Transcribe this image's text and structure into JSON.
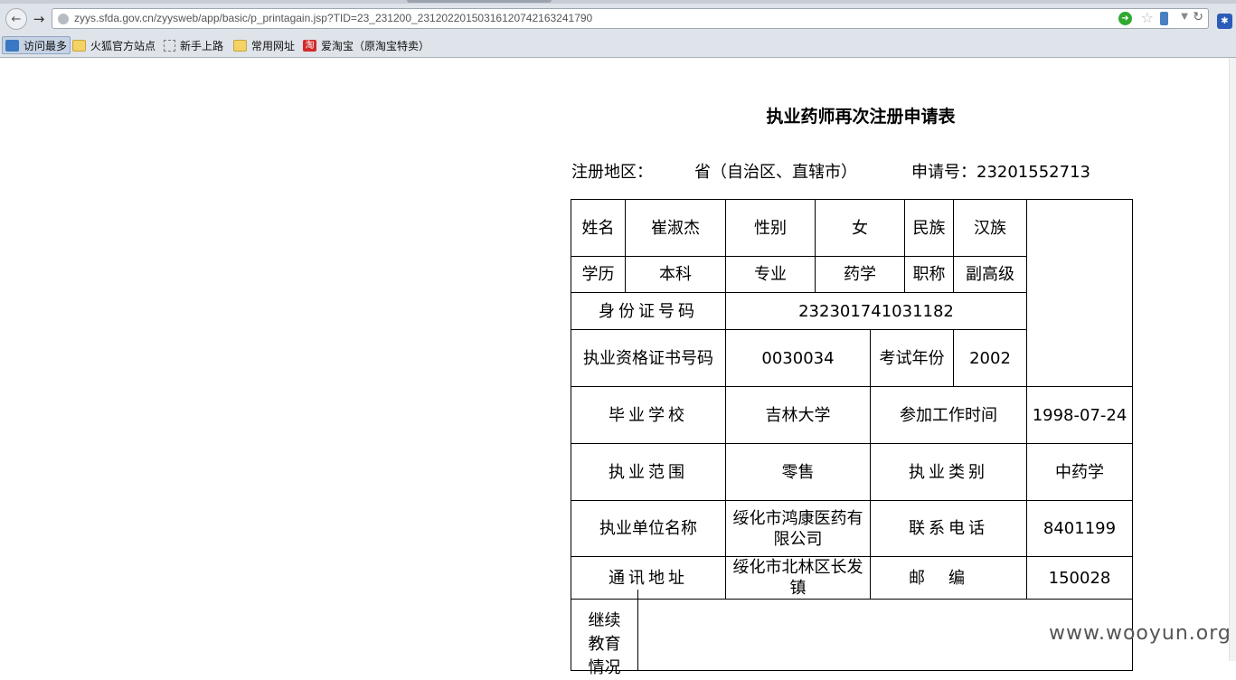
{
  "browser": {
    "url": "zyys.sfda.gov.cn/zyysweb/app/basic/p_printagain.jsp?TID=23_231200_23120220150316120742163241790",
    "bookmarks": [
      "访问最多",
      "火狐官方站点",
      "新手上路",
      "常用网址",
      "爱淘宝（原淘宝特卖）"
    ],
    "taobao_glyph": "淘"
  },
  "form": {
    "title": "执业药师再次注册申请表",
    "region_label": "注册地区：",
    "region_value": "省（自治区、直辖市）",
    "application_no": "申请号：23201552713",
    "rows": {
      "name_label": "姓名",
      "name_value": "崔淑杰",
      "gender_label": "性别",
      "gender_value": "女",
      "ethnic_label": "民族",
      "ethnic_value": "汉族",
      "edu_label": "学历",
      "edu_value": "本科",
      "major_label": "专业",
      "major_value": "药学",
      "title_label": "职称",
      "title_value": "副高级",
      "id_label": "身份证号码",
      "id_value": "232301741031182",
      "cert_label": "执业资格证书号码",
      "cert_value": "0030034",
      "exam_year_label": "考试年份",
      "exam_year_value": "2002",
      "school_label": "毕业学校",
      "school_value": "吉林大学",
      "work_start_label": "参加工作时间",
      "work_start_value": "1998-07-24",
      "scope_label": "执业范围",
      "scope_value": "零售",
      "category_label": "执业类别",
      "category_value": "中药学",
      "employer_label": "执业单位名称",
      "employer_value": "绥化市鸿康医药有限公司",
      "phone_label": "联系电话",
      "phone_value": "8401199",
      "address_label": "通讯地址",
      "address_value": "绥化市北林区长发镇",
      "postcode_label": "邮编",
      "postcode_value": "150028",
      "continuing_edu_label": "继续教育情况"
    }
  },
  "watermark": "www.wooyun.org"
}
